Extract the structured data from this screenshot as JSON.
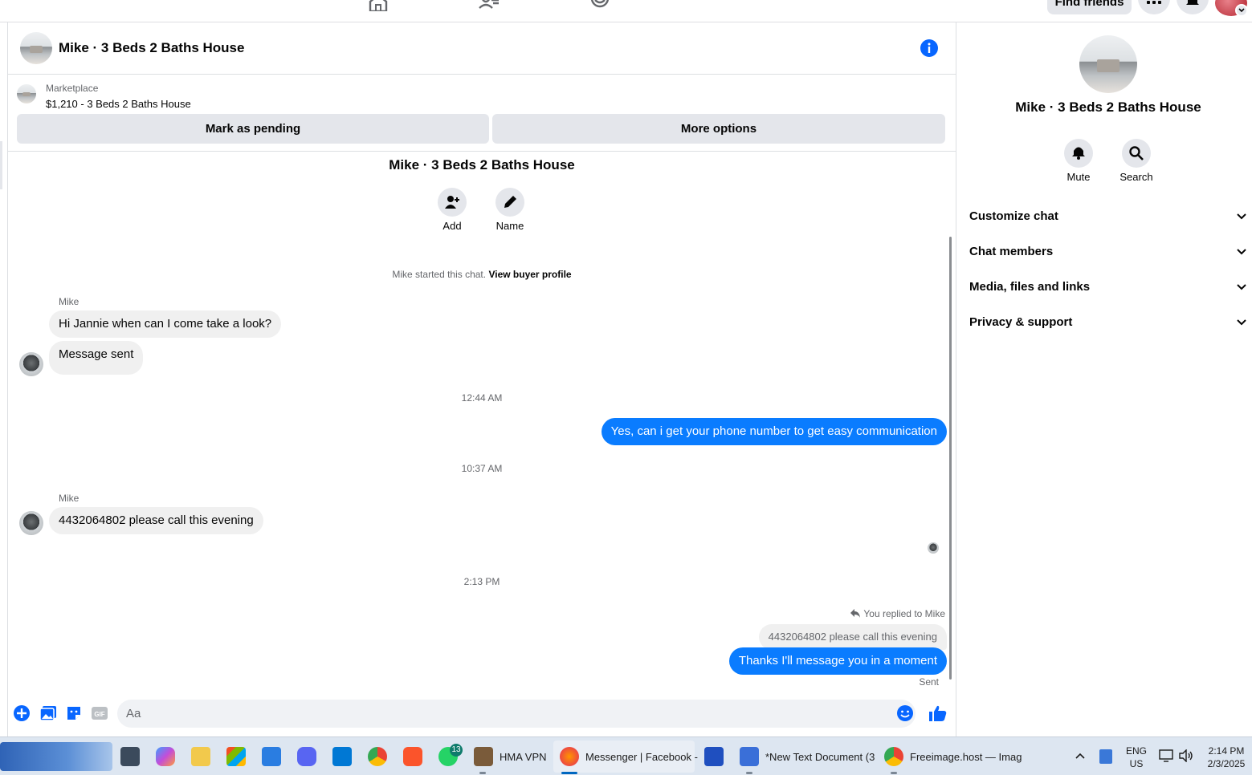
{
  "chat": {
    "title": "Mike · 3 Beds 2 Baths House",
    "marketplace_label": "Marketplace",
    "listing": "$1,210 - 3 Beds 2 Baths House",
    "mark_pending": "Mark as pending",
    "more_options": "More options",
    "intro_title": "Mike · 3 Beds 2 Baths House",
    "add_label": "Add",
    "name_label": "Name",
    "started_text": "Mike started this chat.",
    "view_profile": "View buyer profile"
  },
  "topnav": {
    "find_friends": "Find friends"
  },
  "messages": {
    "sender1": "Mike",
    "msg1": "Hi Jannie when can I come take a look?",
    "msg2": "Message sent",
    "time1": "12:44 AM",
    "out1": "Yes, can i get your phone number to get easy communication",
    "time2": "10:37 AM",
    "sender2": "Mike",
    "msg3": "4432064802 please call this evening",
    "time3": "2:13 PM",
    "replied_to": "You replied to Mike",
    "quoted": "4432064802 please call this evening",
    "out2": "Thanks I'll message you in a moment",
    "status": "Sent"
  },
  "composer": {
    "placeholder": "Aa"
  },
  "right_panel": {
    "title": "Mike · 3 Beds 2 Baths House",
    "mute": "Mute",
    "search": "Search",
    "sections": [
      "Customize chat",
      "Chat members",
      "Media, files and links",
      "Privacy & support"
    ]
  },
  "taskbar": {
    "hma": "HMA VPN",
    "messenger": "Messenger | Facebook -",
    "notepad": "*New Text Document (3",
    "freeimage": "Freeimage.host — Imag",
    "whatsapp_badge": "13",
    "lang1": "ENG",
    "lang2": "US",
    "time": "2:14 PM",
    "date": "2/3/2025"
  },
  "colors": {
    "accent": "#0a7cff",
    "info_blue": "#0866ff",
    "bubble_in": "#f0f0f0",
    "button_gray": "#e4e6eb"
  }
}
